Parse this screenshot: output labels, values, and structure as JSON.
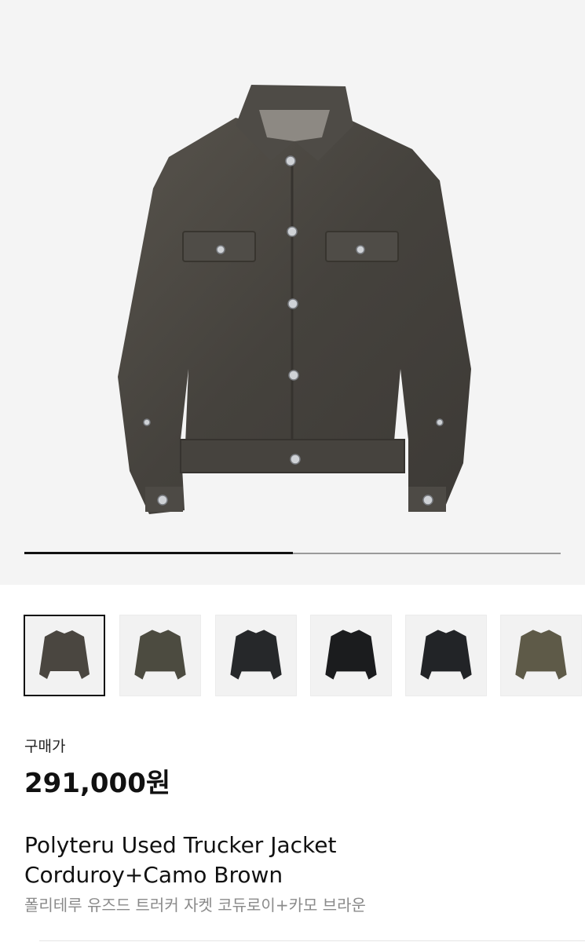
{
  "gallery": {
    "progress": 0.5,
    "thumbnail_colors": [
      "#4a4640",
      "#4c4b40",
      "#26282a",
      "#1b1c1e",
      "#222427",
      "#5e5a48"
    ],
    "selected_index": 0
  },
  "product": {
    "price_label": "구매가",
    "price": "291,000원",
    "name_en_line1": "Polyteru Used Trucker Jacket",
    "name_en_line2": "Corduroy+Camo Brown",
    "name_kr": "폴리테루 유즈드 트러커 자켓 코듀로이+카모 브라운"
  },
  "colors": {
    "hero_background": "#f4f4f4",
    "jacket": "#4b4843",
    "price_text": "#111111",
    "subtitle_text": "#8a8a8a"
  }
}
